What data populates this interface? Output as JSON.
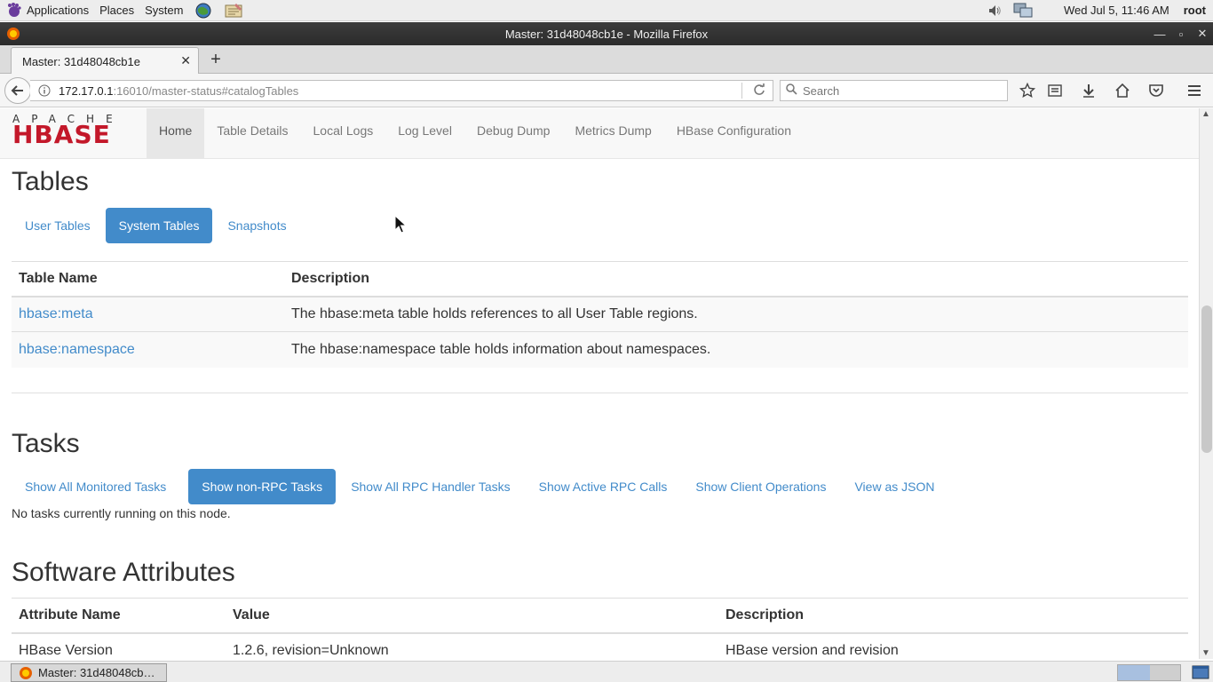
{
  "panel": {
    "applications": "Applications",
    "places": "Places",
    "system": "System",
    "clock": "Wed Jul  5, 11:46 AM",
    "user": "root"
  },
  "window": {
    "title": "Master: 31d48048cb1e - Mozilla Firefox"
  },
  "browser": {
    "tab_title": "Master: 31d48048cb1e",
    "url_host": "172.17.0.1",
    "url_rest": ":16010/master-status#catalogTables",
    "search_placeholder": "Search"
  },
  "hbase_nav": {
    "logo_top": "APACHE",
    "logo_main": "HBASE",
    "items": [
      "Home",
      "Table Details",
      "Local Logs",
      "Log Level",
      "Debug Dump",
      "Metrics Dump",
      "HBase Configuration"
    ],
    "active": "Home"
  },
  "tables": {
    "heading": "Tables",
    "tabs": [
      "User Tables",
      "System Tables",
      "Snapshots"
    ],
    "active_tab": "System Tables",
    "columns": [
      "Table Name",
      "Description"
    ],
    "rows": [
      {
        "name": "hbase:meta",
        "description": "The hbase:meta table holds references to all User Table regions."
      },
      {
        "name": "hbase:namespace",
        "description": "The hbase:namespace table holds information about namespaces."
      }
    ]
  },
  "tasks": {
    "heading": "Tasks",
    "tabs": [
      "Show All Monitored Tasks",
      "Show non-RPC Tasks",
      "Show All RPC Handler Tasks",
      "Show Active RPC Calls",
      "Show Client Operations",
      "View as JSON"
    ],
    "active_tab": "Show non-RPC Tasks",
    "message": "No tasks currently running on this node."
  },
  "software": {
    "heading": "Software Attributes",
    "columns": [
      "Attribute Name",
      "Value",
      "Description"
    ],
    "rows": [
      {
        "name": "HBase Version",
        "value": "1.2.6, revision=Unknown",
        "description": "HBase version and revision"
      }
    ]
  },
  "taskbar": {
    "firefox_label": "Master: 31d48048cb…"
  },
  "colors": {
    "link": "#428bca",
    "hbase_red": "#c3182a",
    "titlebar": "#2b2b2b"
  }
}
